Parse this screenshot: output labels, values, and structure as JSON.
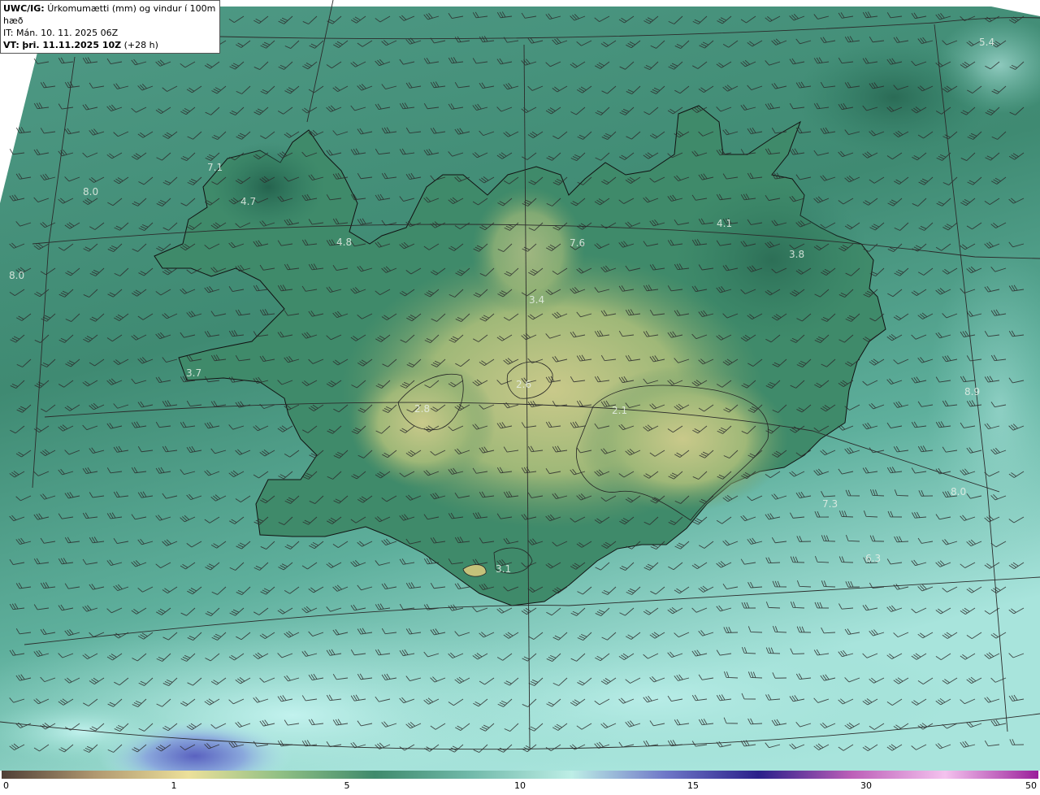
{
  "header": {
    "product_label": "UWC/IG:",
    "product_desc": "Úrkomumætti (mm) og vindur í 100m hæð",
    "init_time": "IT: Mán. 10. 11. 2025 06Z",
    "valid_label": "VT:",
    "valid_time": "þri. 11.11.2025 10Z",
    "lead_time": "(+28 h)"
  },
  "map": {
    "region": "Iceland",
    "value_labels": [
      "5.4",
      "7.1",
      "8.0",
      "4.7",
      "4.8",
      "8.0",
      "4.1",
      "7.6",
      "3.8",
      "3.4",
      "3.7",
      "2.6",
      "2.8",
      "2.1",
      "8.9",
      "7.3",
      "8.0",
      "6.3",
      "3.1"
    ],
    "wind_barbs": "dense grid of wind barbs, predominantly north-easterly flow"
  },
  "colorbar": {
    "ticks": [
      "0",
      "1",
      "5",
      "10",
      "15",
      "30",
      "50"
    ],
    "colors": [
      "#4f3f36",
      "#b09870",
      "#ece09a",
      "#8fbf84",
      "#3f8a6c",
      "#6fb8a8",
      "#bdeee6",
      "#6f78c8",
      "#2a1f8a",
      "#bc5fb8",
      "#f4c2ee",
      "#9a1f9a"
    ]
  }
}
